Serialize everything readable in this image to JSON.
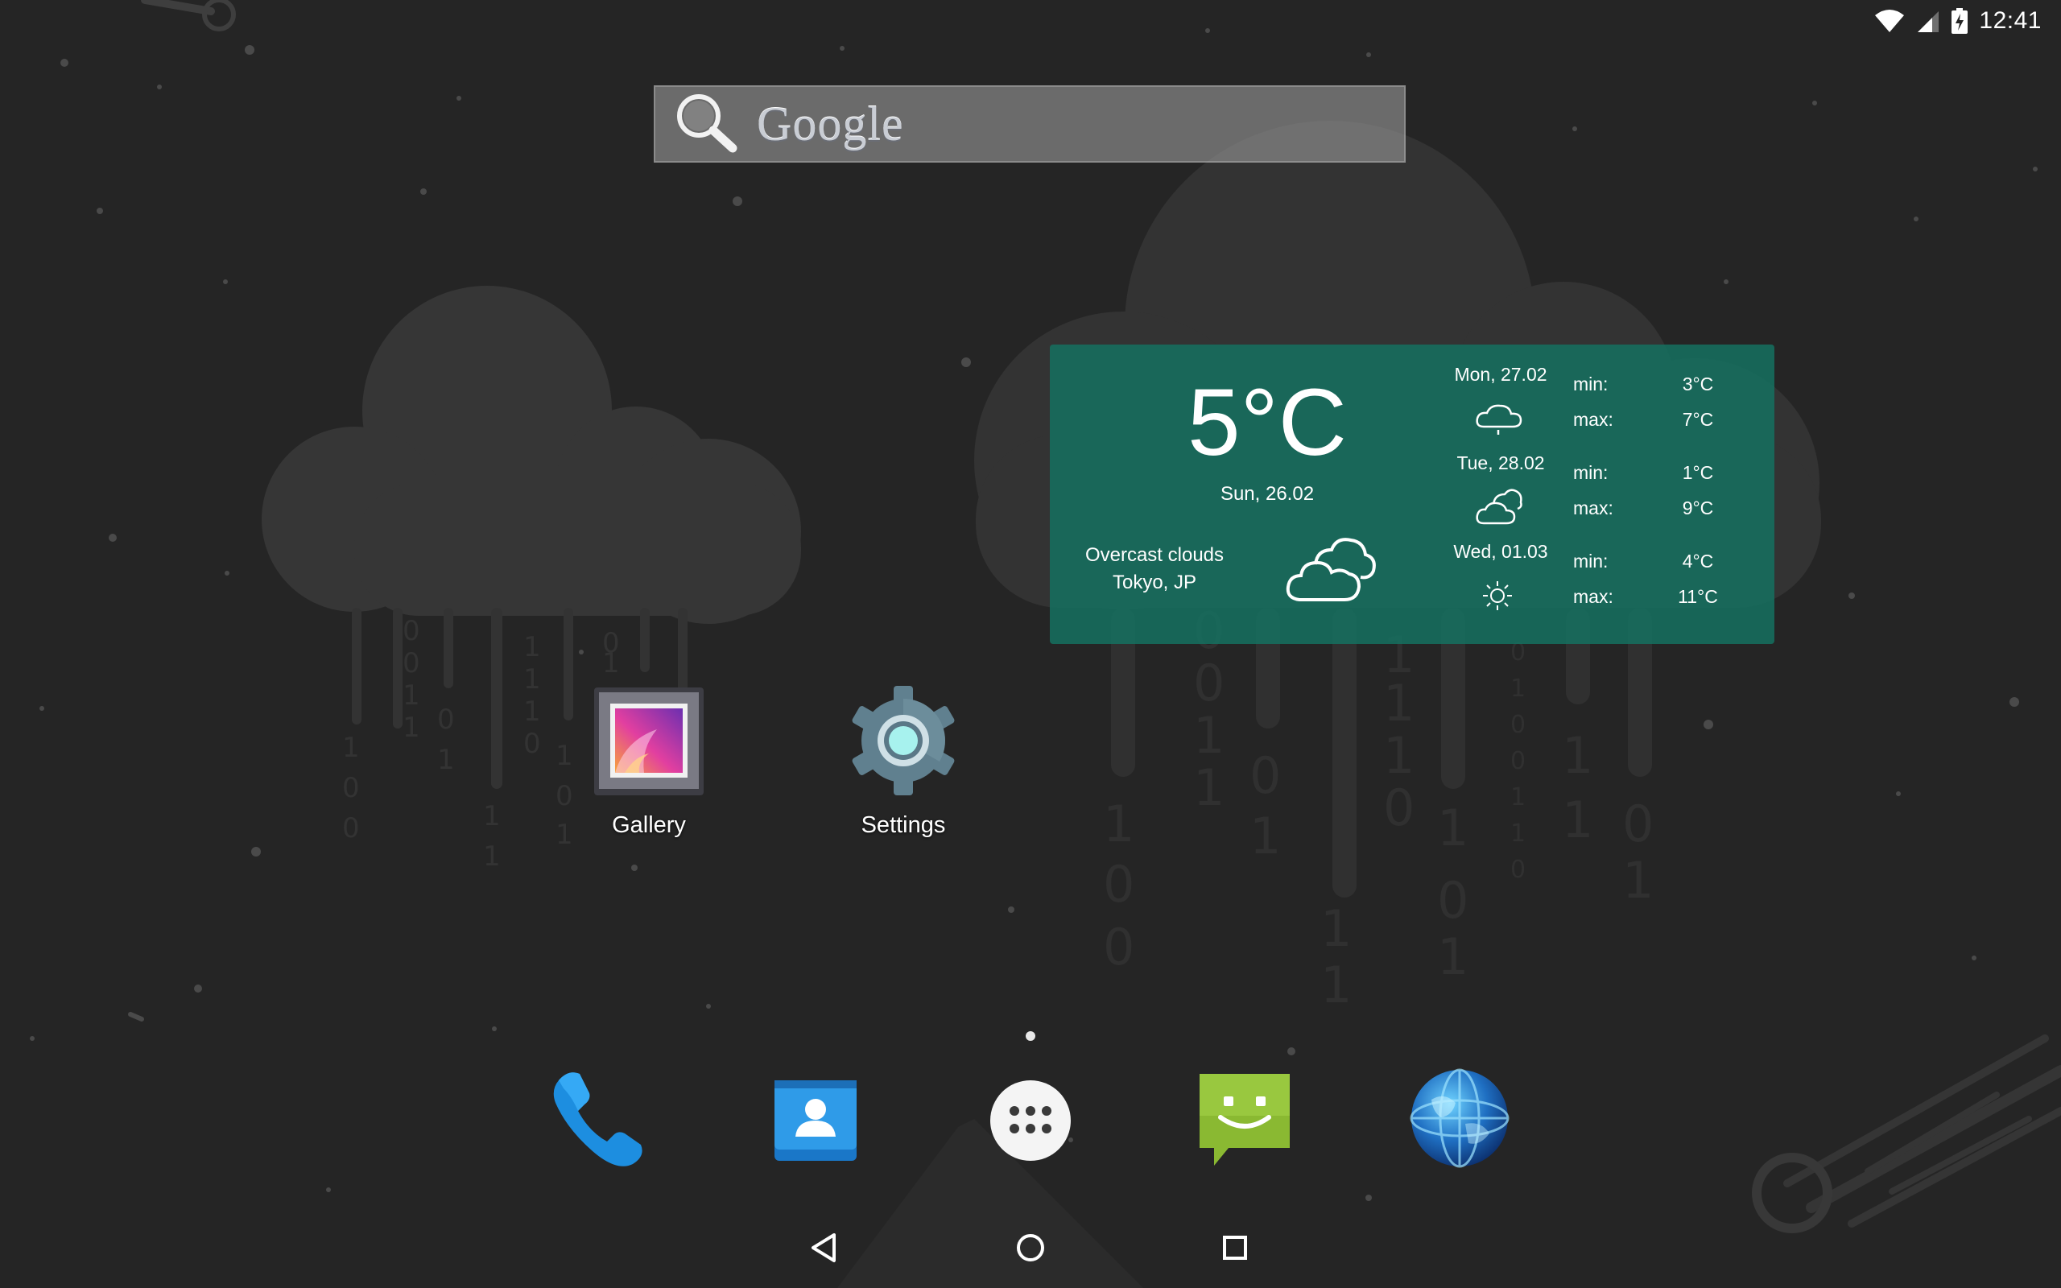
{
  "status_bar": {
    "time": "12:41"
  },
  "search": {
    "brand": "Google"
  },
  "weather": {
    "current_temp": "5°C",
    "current_date": "Sun, 26.02",
    "condition": "Overcast clouds",
    "location": "Tokyo, JP",
    "forecast": [
      {
        "day": "Mon, 27.02",
        "icon": "drizzle-cloud-icon",
        "min_label": "min:",
        "min": "3°C",
        "max_label": "max:",
        "max": "7°C"
      },
      {
        "day": "Tue, 28.02",
        "icon": "clouds-icon",
        "min_label": "min:",
        "min": "1°C",
        "max_label": "max:",
        "max": "9°C"
      },
      {
        "day": "Wed, 01.03",
        "icon": "sun-icon",
        "min_label": "min:",
        "min": "4°C",
        "max_label": "max:",
        "max": "11°C"
      }
    ]
  },
  "apps": [
    {
      "label": "Gallery",
      "icon": "gallery-icon"
    },
    {
      "label": "Settings",
      "icon": "settings-gear-icon"
    }
  ],
  "dock": [
    "phone-icon",
    "contacts-icon",
    "app-drawer-icon",
    "messaging-icon",
    "browser-globe-icon"
  ],
  "nav": [
    "back-icon",
    "home-icon",
    "recents-icon"
  ],
  "colors": {
    "widget_bg": "#166e5e",
    "background": "#252525",
    "search_bg": "#969696"
  }
}
